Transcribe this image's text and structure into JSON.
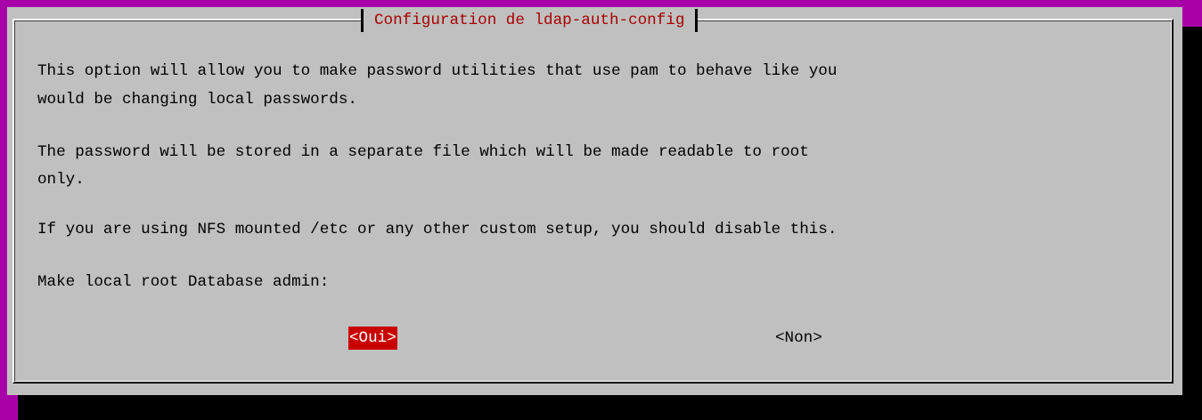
{
  "dialog": {
    "title": "Configuration de ldap-auth-config",
    "lines": [
      "This option will allow you to make password utilities that use pam to behave like you",
      "would be changing local passwords.",
      "The password will be stored in a separate file which will be made readable to root",
      "only.",
      "If you are using NFS mounted /etc or any other custom setup, you should disable this.",
      "Make local root Database admin:"
    ],
    "buttons": {
      "yes": "<Oui>",
      "no": "<Non>"
    }
  },
  "colors": {
    "screen_background": "#a800a8",
    "dialog_background": "#c0c0c0",
    "title_text": "#a80000",
    "selected_button_background": "#c80000",
    "selected_button_text": "#ffffff"
  }
}
